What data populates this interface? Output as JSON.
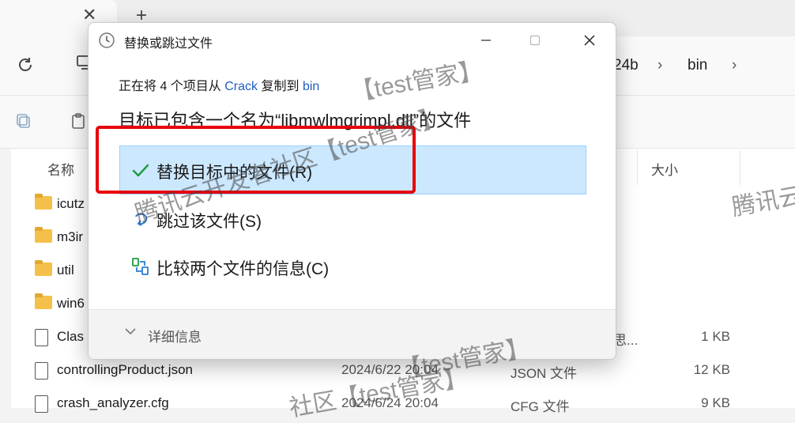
{
  "explorer": {
    "breadcrumb": [
      "24b",
      "bin"
    ],
    "columns": {
      "name": "名称",
      "size": "大小"
    },
    "rows": [
      {
        "kind": "folder",
        "name": "icutz",
        "date": "",
        "type": "",
        "size": ""
      },
      {
        "kind": "folder",
        "name": "m3ir",
        "date": "",
        "type": "",
        "size": ""
      },
      {
        "kind": "folder",
        "name": "util",
        "date": "",
        "type": "",
        "size": ""
      },
      {
        "kind": "folder",
        "name": "win6",
        "date": "",
        "type": "",
        "size": ""
      },
      {
        "kind": "file",
        "name": "Clas",
        "date": "",
        "type": "",
        "extra": "思...",
        "size": "1 KB"
      },
      {
        "kind": "file",
        "name": "controllingProduct.json",
        "date": "2024/6/22 20:04",
        "type": "JSON 文件",
        "size": "12 KB"
      },
      {
        "kind": "file",
        "name": "crash_analyzer.cfg",
        "date": "2024/6/24 20:04",
        "type": "CFG 文件",
        "size": "9 KB"
      }
    ]
  },
  "dialog": {
    "title": "替换或跳过文件",
    "info_prefix": "正在将 4 个项目从 ",
    "source": "Crack",
    "info_middle": " 复制到 ",
    "destination": "bin",
    "heading": "目标已包含一个名为“libmwlmgrimpl.dll”的文件",
    "options": [
      {
        "label": "替换目标中的文件(R)",
        "icon": "checkmark-icon",
        "selected": true
      },
      {
        "label": "跳过该文件(S)",
        "icon": "skip-arrow-icon",
        "selected": false
      },
      {
        "label": "比较两个文件的信息(C)",
        "icon": "compare-icon",
        "selected": false
      }
    ],
    "details_label": "详细信息"
  },
  "watermarks": [
    {
      "text": "【test管家】"
    },
    {
      "text": "腾讯云开发者社区【test管家】"
    },
    {
      "text": "腾讯云"
    },
    {
      "text": "【test管家】"
    },
    {
      "text": "社区【test管家】"
    }
  ],
  "colors": {
    "accent": "#1f5fbf",
    "selected_bg": "#cce8ff",
    "selected_border": "#99d1ff",
    "annotation_red": "#e8000b",
    "checkmark_green": "#1e9b3c"
  }
}
